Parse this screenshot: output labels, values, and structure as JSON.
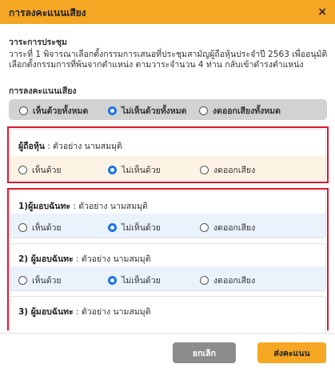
{
  "header": {
    "title": "การลงคะแนนเสียง",
    "close_label": "×"
  },
  "agenda": {
    "label": "วาระการประชุม",
    "text": "วาระที่ 1 พิจารณาเลือกตั้งกรรมการเสนอที่ประชุมสามัญผู้ถือหุ้นประจำปี 2563 เพื่ออนุมัติเลือกตั้งกรรมการที่พ้นจากตำแหน่ง ตามวาระจำนวน 4 ท่าน กลับเข้าดำรงตำแหน่ง"
  },
  "voting": {
    "label": "การลงคะแนนเสียง",
    "global_options": [
      {
        "label": "เห็นด้วยทั้งหมด",
        "selected": false
      },
      {
        "label": "ไม่เห็นด้วยทั้งหมด",
        "selected": true
      },
      {
        "label": "งดออกเสียงทั้งหมด",
        "selected": false
      }
    ]
  },
  "shareholder": {
    "title_bold": "ผู้ถือหุ้น",
    "title_rest": " : ตัวอย่าง นามสมมุติ",
    "options": [
      {
        "label": "เห็นด้วย",
        "selected": false
      },
      {
        "label": "ไม่เห็นด้วย",
        "selected": true
      },
      {
        "label": "งดออกเสียง",
        "selected": false
      }
    ]
  },
  "proxies": [
    {
      "title_bold": "1)ผู้มอบฉันทะ",
      "title_rest": " : ตัวอย่าง นามสมมุติ",
      "options": [
        {
          "label": "เห็นด้วย",
          "selected": false
        },
        {
          "label": "ไม่เห็นด้วย",
          "selected": true
        },
        {
          "label": "งดออกเสียง",
          "selected": false
        }
      ]
    },
    {
      "title_bold": "2) ผู้มอบฉันทะ",
      "title_rest": " : ตัวอย่าง นามสมมุติ",
      "options": [
        {
          "label": "เห็นด้วย",
          "selected": false
        },
        {
          "label": "ไม่เห็นด้วย",
          "selected": true
        },
        {
          "label": "งดออกเสียง",
          "selected": false
        }
      ]
    },
    {
      "title_bold": "3) ผู้มอบฉันทะ",
      "title_rest": " : ตัวอย่าง นามสมมุติ"
    }
  ],
  "footer": {
    "cancel_label": "ยกเลิก",
    "submit_label": "ส่งคะแนน"
  },
  "colors": {
    "accent": "#f5a623",
    "highlight": "#e0182d",
    "radio_selected": "#1a73e8"
  }
}
